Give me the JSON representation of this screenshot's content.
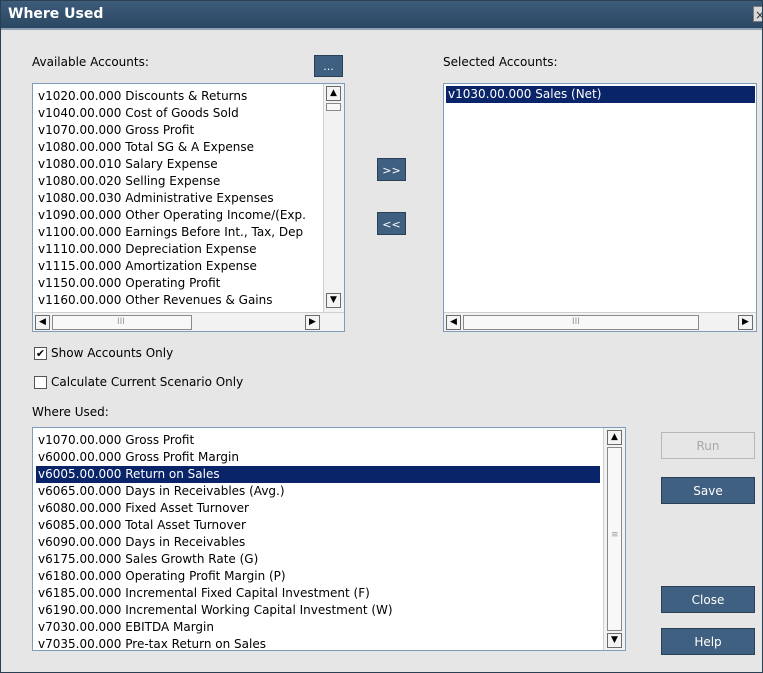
{
  "window": {
    "title": "Where Used",
    "close_glyph": "×"
  },
  "available": {
    "label": "Available Accounts:",
    "browse_label": "...",
    "items": [
      "v1020.00.000  Discounts & Returns",
      "v1040.00.000  Cost of Goods Sold",
      "v1070.00.000  Gross Profit",
      "v1080.00.000  Total SG & A Expense",
      "v1080.00.010  Salary Expense",
      "v1080.00.020  Selling Expense",
      "v1080.00.030  Administrative Expenses",
      "v1090.00.000  Other Operating Income/(Exp.",
      "v1100.00.000  Earnings Before Int., Tax, Dep",
      "v1110.00.000  Depreciation Expense",
      "v1115.00.000  Amortization Expense",
      "v1150.00.000  Operating Profit",
      "v1160.00.000  Other Revenues & Gains"
    ]
  },
  "transfer": {
    "add_label": ">>",
    "remove_label": "<<"
  },
  "selected": {
    "label": "Selected Accounts:",
    "items": [
      "v1030.00.000  Sales (Net)"
    ]
  },
  "options": {
    "show_accounts_only": {
      "label": "Show Accounts Only",
      "checked": true,
      "check_glyph": "✔"
    },
    "calculate_current_scenario": {
      "label": "Calculate Current Scenario Only",
      "checked": false
    }
  },
  "where_used": {
    "label": "Where Used:",
    "items": [
      "v1070.00.000  Gross Profit",
      "v6000.00.000  Gross Profit Margin",
      "v6005.00.000  Return on Sales",
      "v6065.00.000  Days in Receivables (Avg.)",
      "v6080.00.000  Fixed Asset Turnover",
      "v6085.00.000  Total Asset Turnover",
      "v6090.00.000  Days in Receivables",
      "v6175.00.000  Sales Growth Rate (G)",
      "v6180.00.000  Operating Profit Margin (P)",
      "v6185.00.000  Incremental Fixed Capital Investment (F)",
      "v6190.00.000  Incremental Working Capital Investment (W)",
      "v7030.00.000  EBITDA Margin",
      "v7035.00.000  Pre-tax Return on Sales"
    ]
  },
  "buttons": {
    "run": "Run",
    "save": "Save",
    "close": "Close",
    "help": "Help"
  },
  "scroll": {
    "up": "▲",
    "down": "▼",
    "left": "◀",
    "right": "▶",
    "grip_v": "≡",
    "grip_h": "III"
  }
}
